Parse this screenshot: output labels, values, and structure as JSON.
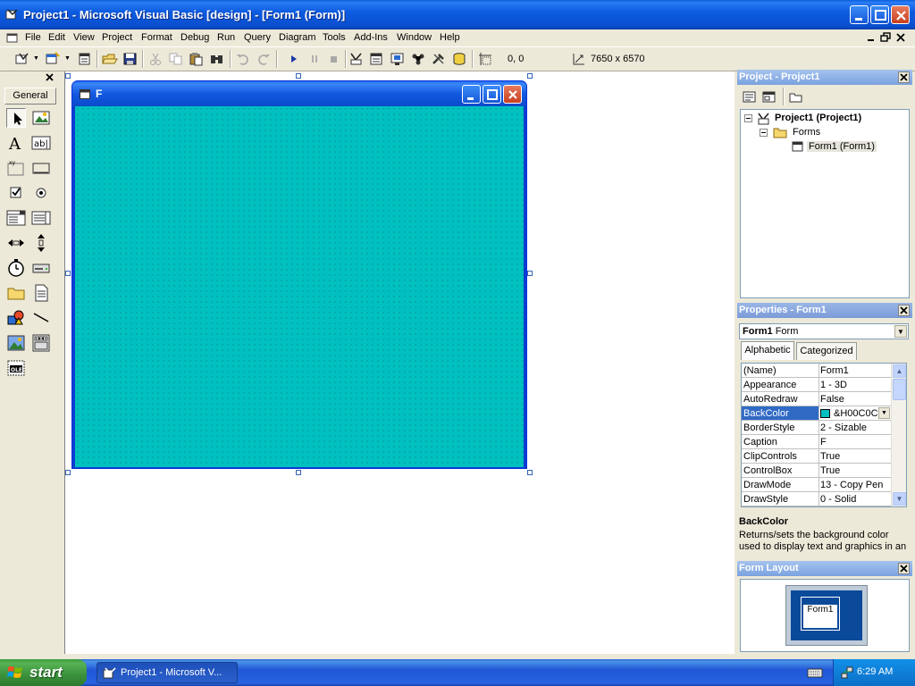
{
  "window": {
    "title": "Project1 - Microsoft Visual Basic [design] - [Form1 (Form)]"
  },
  "menu": [
    "File",
    "Edit",
    "View",
    "Project",
    "Format",
    "Debug",
    "Run",
    "Query",
    "Diagram",
    "Tools",
    "Add-Ins",
    "Window",
    "Help"
  ],
  "toolbar": {
    "position": "0, 0",
    "size": "7650 x 6570"
  },
  "toolbox": {
    "tab": "General"
  },
  "form": {
    "caption": "F",
    "backcolor": "#00c0c0"
  },
  "project_explorer": {
    "title": "Project - Project1",
    "root": "Project1 (Project1)",
    "folder": "Forms",
    "item": "Form1 (Form1)"
  },
  "properties": {
    "title": "Properties - Form1",
    "object_name": "Form1",
    "object_type": "Form",
    "tabs": [
      "Alphabetic",
      "Categorized"
    ],
    "rows": [
      {
        "name": "(Name)",
        "value": "Form1"
      },
      {
        "name": "Appearance",
        "value": "1 - 3D"
      },
      {
        "name": "AutoRedraw",
        "value": "False"
      },
      {
        "name": "BackColor",
        "value": "&H00C0C"
      },
      {
        "name": "BorderStyle",
        "value": "2 - Sizable"
      },
      {
        "name": "Caption",
        "value": "F"
      },
      {
        "name": "ClipControls",
        "value": "True"
      },
      {
        "name": "ControlBox",
        "value": "True"
      },
      {
        "name": "DrawMode",
        "value": "13 - Copy Pen"
      },
      {
        "name": "DrawStyle",
        "value": "0 - Solid"
      }
    ],
    "selected_index": 3,
    "desc_title": "BackColor",
    "desc_text": "Returns/sets the background color used to display text and graphics in an"
  },
  "form_layout": {
    "title": "Form Layout",
    "form_label": "Form1"
  },
  "taskbar": {
    "start": "start",
    "task": "Project1 - Microsoft V...",
    "clock": "6:29 AM"
  }
}
